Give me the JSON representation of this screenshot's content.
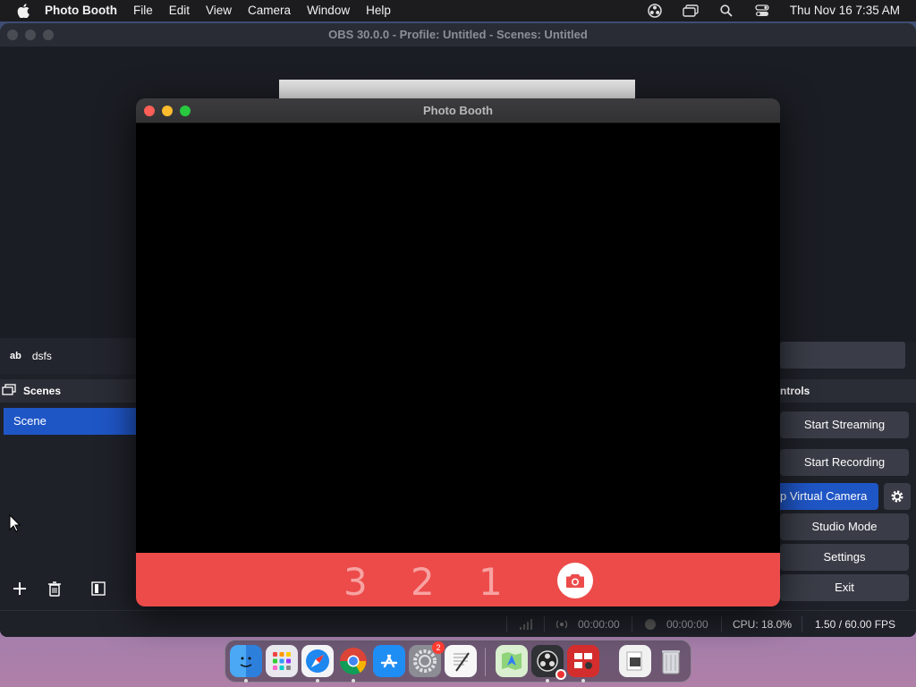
{
  "menubar": {
    "app_name": "Photo Booth",
    "items": [
      "File",
      "Edit",
      "View",
      "Camera",
      "Window",
      "Help"
    ],
    "clock": "Thu Nov 16  7:35 AM"
  },
  "obs": {
    "title": "OBS 30.0.0 - Profile: Untitled - Scenes: Untitled",
    "source": {
      "type_label": "ab",
      "name": "dsfs"
    },
    "scenes_header": "Scenes",
    "scenes": [
      "Scene"
    ],
    "controls_header": "ntrols",
    "controls": {
      "start_streaming": "Start Streaming",
      "start_recording": "Start Recording",
      "virtual_camera": "p Virtual Camera",
      "studio_mode": "Studio Mode",
      "settings": "Settings",
      "exit": "Exit"
    },
    "status": {
      "stream_time": "00:00:00",
      "record_time": "00:00:00",
      "cpu": "CPU: 18.0%",
      "fps": "1.50 / 60.00 FPS"
    },
    "accent_color": "#1f56c6"
  },
  "photobooth": {
    "title": "Photo Booth",
    "countdown": [
      "3",
      "2",
      "1"
    ],
    "bar_color": "#ec4b4a"
  },
  "dock": {
    "apps": [
      "Finder",
      "Launchpad",
      "Safari",
      "Chrome",
      "App Store",
      "System Settings",
      "TextEdit",
      "Maps",
      "OBS",
      "Photo Booth",
      "Preview",
      "Trash"
    ],
    "settings_badge": "2"
  }
}
